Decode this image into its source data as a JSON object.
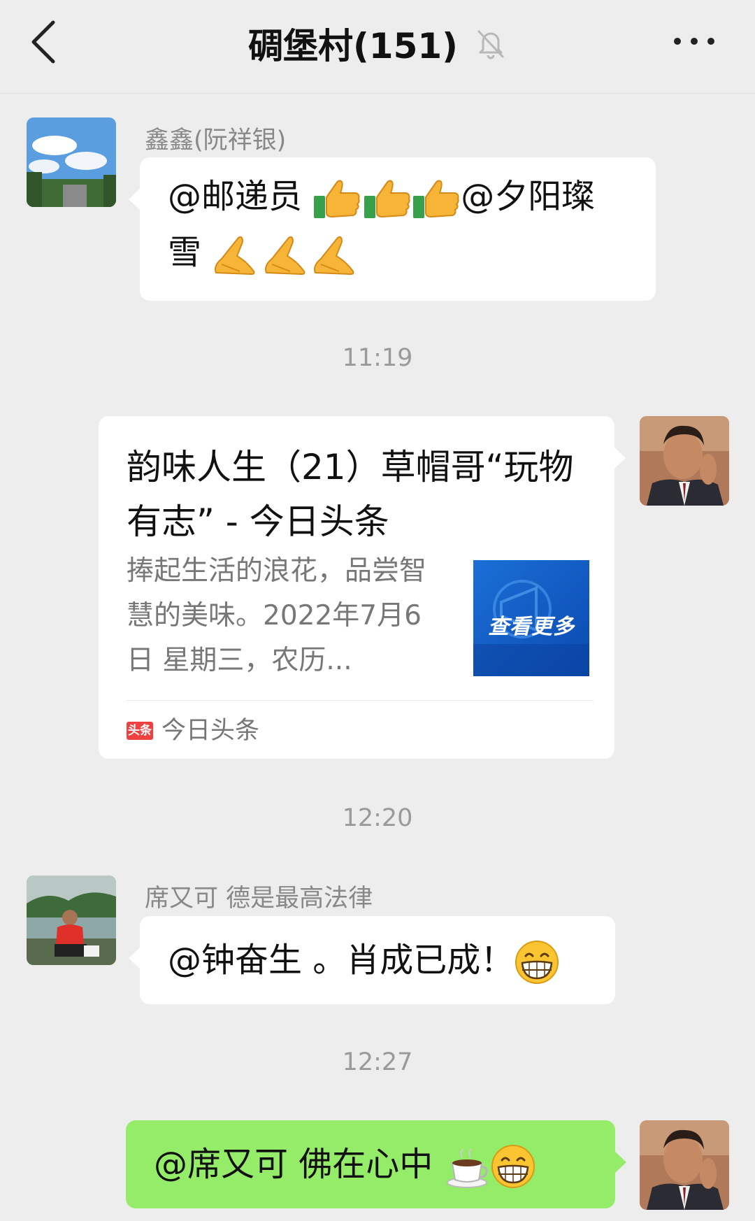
{
  "header": {
    "title": "碉堡村(151)",
    "back_icon": "chevron-left-icon",
    "mute_icon": "bell-off-icon",
    "more_icon": "ellipsis-icon"
  },
  "messages": [
    {
      "sender": "鑫鑫(阮祥银)",
      "text_1": "@邮递员 ",
      "text_2": "@夕阳璨",
      "text_3": "雪 ",
      "emojis_a": "thumbs-up-icon",
      "emojis_b": "folded-hands-icon"
    },
    {
      "card_title": "韵味人生（21）草帽哥“玩物有志” - 今日头条",
      "card_desc": "捧起生活的浪花，品尝智慧的美味。2022年7月6日 星期三，农历...",
      "card_thumb_text": "查看更多",
      "card_source": "今日头条",
      "card_source_logo": "头条"
    },
    {
      "sender": "席又可  德是最高法律",
      "text": "@钟奋生  。肖成已成！"
    },
    {
      "text": "@席又可  佛在心中 "
    }
  ],
  "timestamps": [
    "11:19",
    "12:20",
    "12:27"
  ],
  "colors": {
    "background": "#ededed",
    "bubble": "#ffffff",
    "self_bubble": "#95ec69",
    "toutiao_red": "#f04142"
  }
}
